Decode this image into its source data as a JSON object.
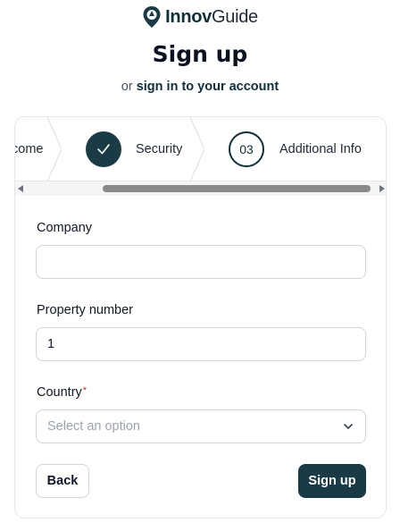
{
  "brand": {
    "name_bold": "Innov",
    "name_regular": "Guide",
    "icon": "location-pin-icon"
  },
  "header": {
    "title": "Sign up",
    "subtitle_prefix": "or",
    "subtitle_link": "sign in to your account"
  },
  "steps": [
    {
      "label": "come",
      "status": "partial-visible"
    },
    {
      "label": "Security",
      "status": "complete",
      "icon": "check-icon"
    },
    {
      "label": "Additional Info",
      "status": "current",
      "number": "03"
    }
  ],
  "form": {
    "company": {
      "label": "Company",
      "value": "",
      "placeholder": ""
    },
    "property_number": {
      "label": "Property number",
      "value": "1"
    },
    "country": {
      "label": "Country",
      "required_marker": "*",
      "placeholder": "Select an option",
      "icon": "chevron-down-icon"
    }
  },
  "actions": {
    "back_label": "Back",
    "signup_label": "Sign up"
  },
  "colors": {
    "primary": "#1a3a45",
    "border": "#d1d5db",
    "required": "#dc2626"
  }
}
